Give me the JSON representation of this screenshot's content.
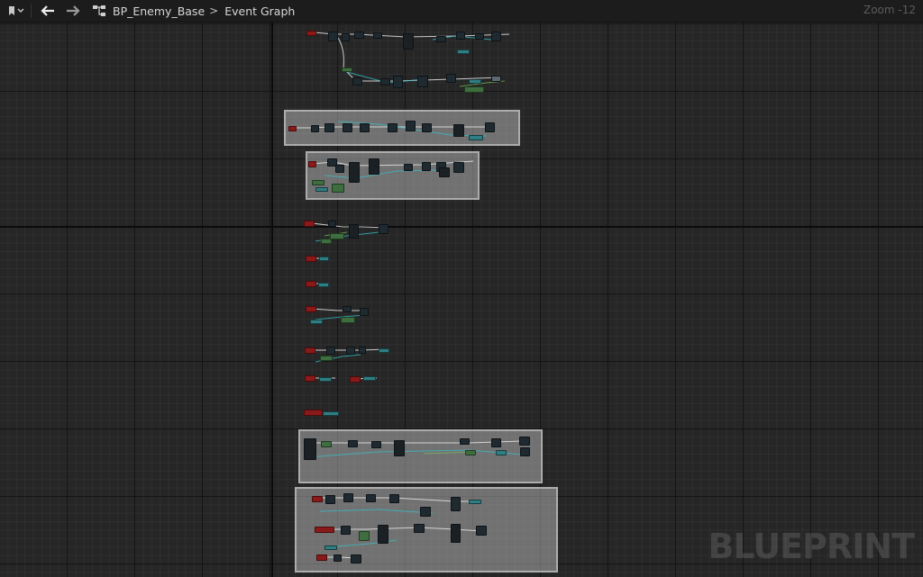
{
  "toolbar": {
    "bookmark_icon": "bookmark-icon",
    "back_icon": "arrow-left-icon",
    "forward_icon": "arrow-right-icon",
    "graph_icon": "graph-hierarchy-icon"
  },
  "breadcrumb": {
    "asset": "BP_Enemy_Base",
    "separator": ">",
    "graph": "Event Graph"
  },
  "zoom_label": "Zoom -12",
  "watermark": "BLUEPRINT",
  "colors": {
    "background": "#262626",
    "exec_wire": "#e6e6e6",
    "data_wire": "#35c0c8",
    "bool_wire": "#7fbf5a",
    "event_node": "#8a1a1a",
    "comment_box": "#bcbcbc"
  }
}
